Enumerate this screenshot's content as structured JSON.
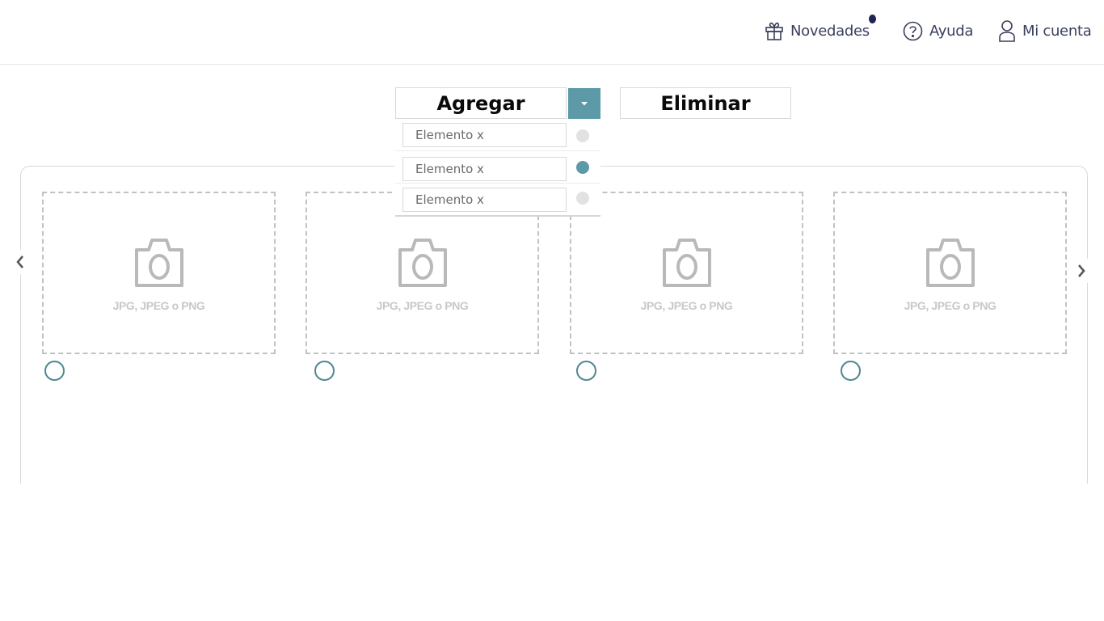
{
  "header": {
    "nav": [
      {
        "label": "Novedades",
        "icon": "gift-icon"
      },
      {
        "label": "Ayuda",
        "icon": "help-circle-icon"
      },
      {
        "label": "Mi cuenta",
        "icon": "user-icon"
      }
    ]
  },
  "actions": {
    "add_label": "Agregar",
    "delete_label": "Eliminar",
    "toggle_icon": "caret-down-icon"
  },
  "dropdown": {
    "items": [
      {
        "label": "Elemento x",
        "selected": false
      },
      {
        "label": "Elemento x",
        "selected": true
      },
      {
        "label": "Elemento x",
        "selected": false
      }
    ]
  },
  "gallery": {
    "slots": [
      {
        "hint": "JPG, JPEG o PNG",
        "icon": "camera-icon"
      },
      {
        "hint": "JPG, JPEG o PNG",
        "icon": "camera-icon"
      },
      {
        "hint": "JPG, JPEG o PNG",
        "icon": "camera-icon"
      },
      {
        "hint": "JPG, JPEG o PNG",
        "icon": "camera-icon"
      }
    ],
    "prev_icon": "chevron-left-icon",
    "next_icon": "chevron-right-icon"
  },
  "colors": {
    "accent": "#5b9aa6",
    "radio_ring": "#4f8893",
    "notification_dot": "#1f2452",
    "nav_text": "#3a3f5c",
    "placeholder_gray": "#c2c2c2"
  }
}
